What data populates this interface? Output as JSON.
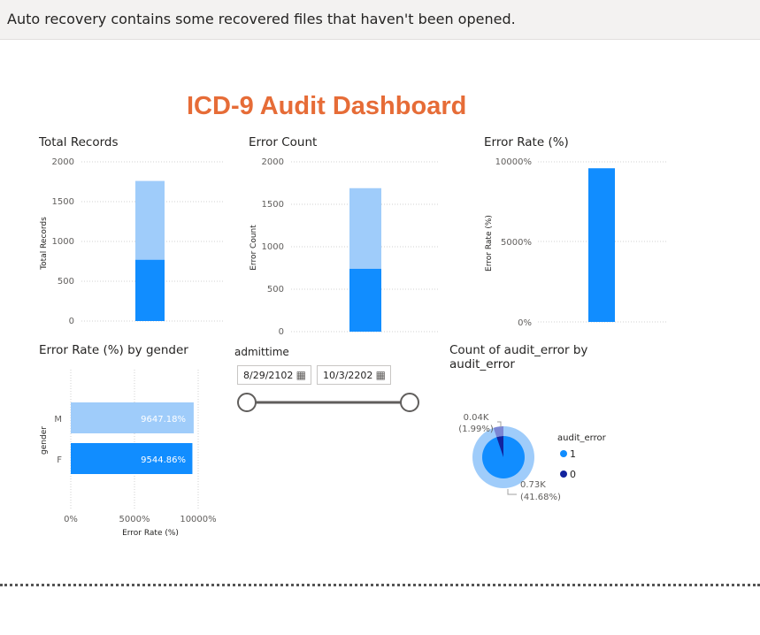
{
  "banner": {
    "text": "Auto recovery contains some recovered files that haven't been opened."
  },
  "dashboard_title": "ICD-9 Audit Dashboard",
  "colors": {
    "light_blue": "#9fccfa",
    "blue": "#118dff",
    "dark_blue": "#12239e",
    "title_orange": "#e66c37"
  },
  "total_records": {
    "title": "Total Records",
    "ylabel": "Total Records",
    "ticks": [
      "2000",
      "1500",
      "1000",
      "500",
      "0"
    ]
  },
  "error_count": {
    "title": "Error Count",
    "ylabel": "Error Count",
    "ticks": [
      "2000",
      "1500",
      "1000",
      "500",
      "0"
    ]
  },
  "error_rate": {
    "title": "Error Rate (%)",
    "ylabel": "Error Rate (%)",
    "ticks": [
      "10000%",
      "5000%",
      "0%"
    ]
  },
  "gender_chart": {
    "title": "Error Rate (%) by gender",
    "ylabel": "gender",
    "xlabel": "Error Rate (%)",
    "xticks": [
      "0%",
      "5000%",
      "10000%"
    ],
    "categories": [
      "M",
      "F"
    ],
    "labels": [
      "9647.18%",
      "9544.86%"
    ]
  },
  "slicer": {
    "label": "admittime",
    "start": "8/29/2102",
    "end": "10/3/2202",
    "calendar_icon": "calendar-icon"
  },
  "pie_chart": {
    "title_line1": "Count of audit_error by",
    "title_line2": "audit_error",
    "legend_title": "audit_error",
    "legend": [
      "1",
      "0"
    ],
    "label_small_1": "0.04K",
    "label_small_2": "(1.99%)",
    "label_big_1": "0.73K",
    "label_big_2": "(41.68%)"
  },
  "chart_data": [
    {
      "type": "bar",
      "title": "Total Records",
      "ylabel": "Total Records",
      "ylim": [
        0,
        2000
      ],
      "categories": [
        ""
      ],
      "series": [
        {
          "values": [
            770
          ]
        },
        {
          "values": [
            990
          ]
        }
      ]
    },
    {
      "type": "bar",
      "title": "Error Count",
      "ylabel": "Error Count",
      "ylim": [
        0,
        2000
      ],
      "categories": [
        ""
      ],
      "series": [
        {
          "values": [
            740
          ]
        },
        {
          "values": [
            950
          ]
        }
      ]
    },
    {
      "type": "bar",
      "title": "Error Rate (%)",
      "ylabel": "Error Rate (%)",
      "ylim": [
        0,
        10000
      ],
      "categories": [
        ""
      ],
      "values": [
        9600
      ]
    },
    {
      "type": "bar",
      "title": "Error Rate (%) by gender",
      "xlabel": "Error Rate (%)",
      "ylabel": "gender",
      "categories": [
        "M",
        "F"
      ],
      "values": [
        9647.18,
        9544.86
      ],
      "xlim": [
        0,
        10000
      ]
    },
    {
      "type": "pie",
      "title": "Count of audit_error by audit_error",
      "categories": [
        "1",
        "0"
      ],
      "values": [
        730,
        40
      ],
      "labels": [
        "0.73K (41.68%)",
        "0.04K (1.99%)"
      ]
    }
  ]
}
